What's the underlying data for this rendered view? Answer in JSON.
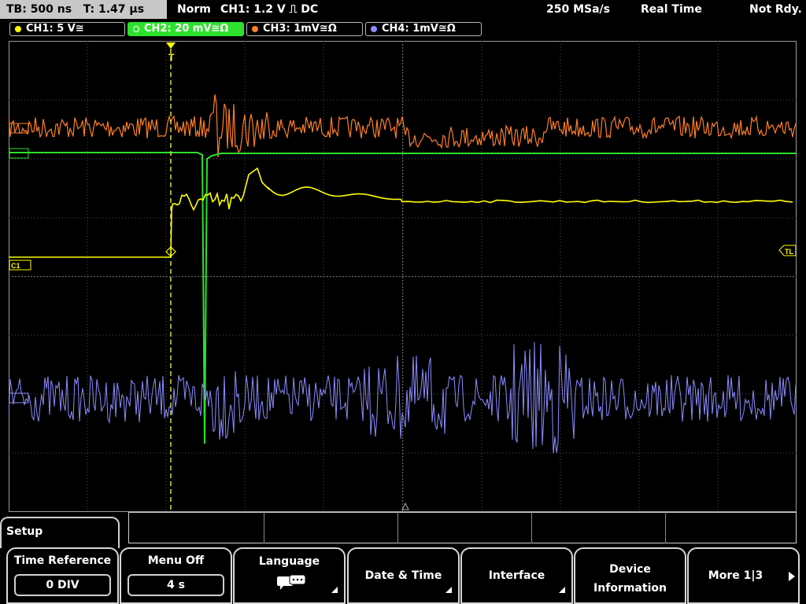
{
  "topbar": {
    "timebase": "TB: 500 ns   T: 1.47 µs",
    "mode": "Norm",
    "trigger": "CH1: 1.2 V ⎍ DC",
    "sample_rate": "250 MSa/s",
    "acquisition": "Real Time",
    "status": "Not Rdy."
  },
  "channels": [
    {
      "label": "CH1: 5 V≅",
      "color": "#ffff00"
    },
    {
      "label": "CH2: 20 mV≅Ω",
      "color": "#2ee02e"
    },
    {
      "label": "CH3: 1mV≅Ω",
      "color": "#ff7f27"
    },
    {
      "label": "CH4: 1mV≅Ω",
      "color": "#8c8cff"
    }
  ],
  "markers": {
    "trigger_level": "TL",
    "ch1": "C1",
    "trigger_pos": "T"
  },
  "menu": {
    "title": "Setup",
    "softkeys": [
      {
        "label": "Time Reference",
        "value": "0 DIV"
      },
      {
        "label": "Menu Off",
        "value": "4 s"
      },
      {
        "label": "Language",
        "icon": "speech-bubble-icon"
      },
      {
        "label": "Date & Time"
      },
      {
        "label": "Interface"
      },
      {
        "label": "Device\nInformation"
      },
      {
        "label": "More 1|3"
      }
    ]
  },
  "colors": {
    "ch1": "#ffff00",
    "ch2": "#2ee02e",
    "ch3": "#ff7f27",
    "ch4": "#8c8cff",
    "grid": "#505050"
  }
}
